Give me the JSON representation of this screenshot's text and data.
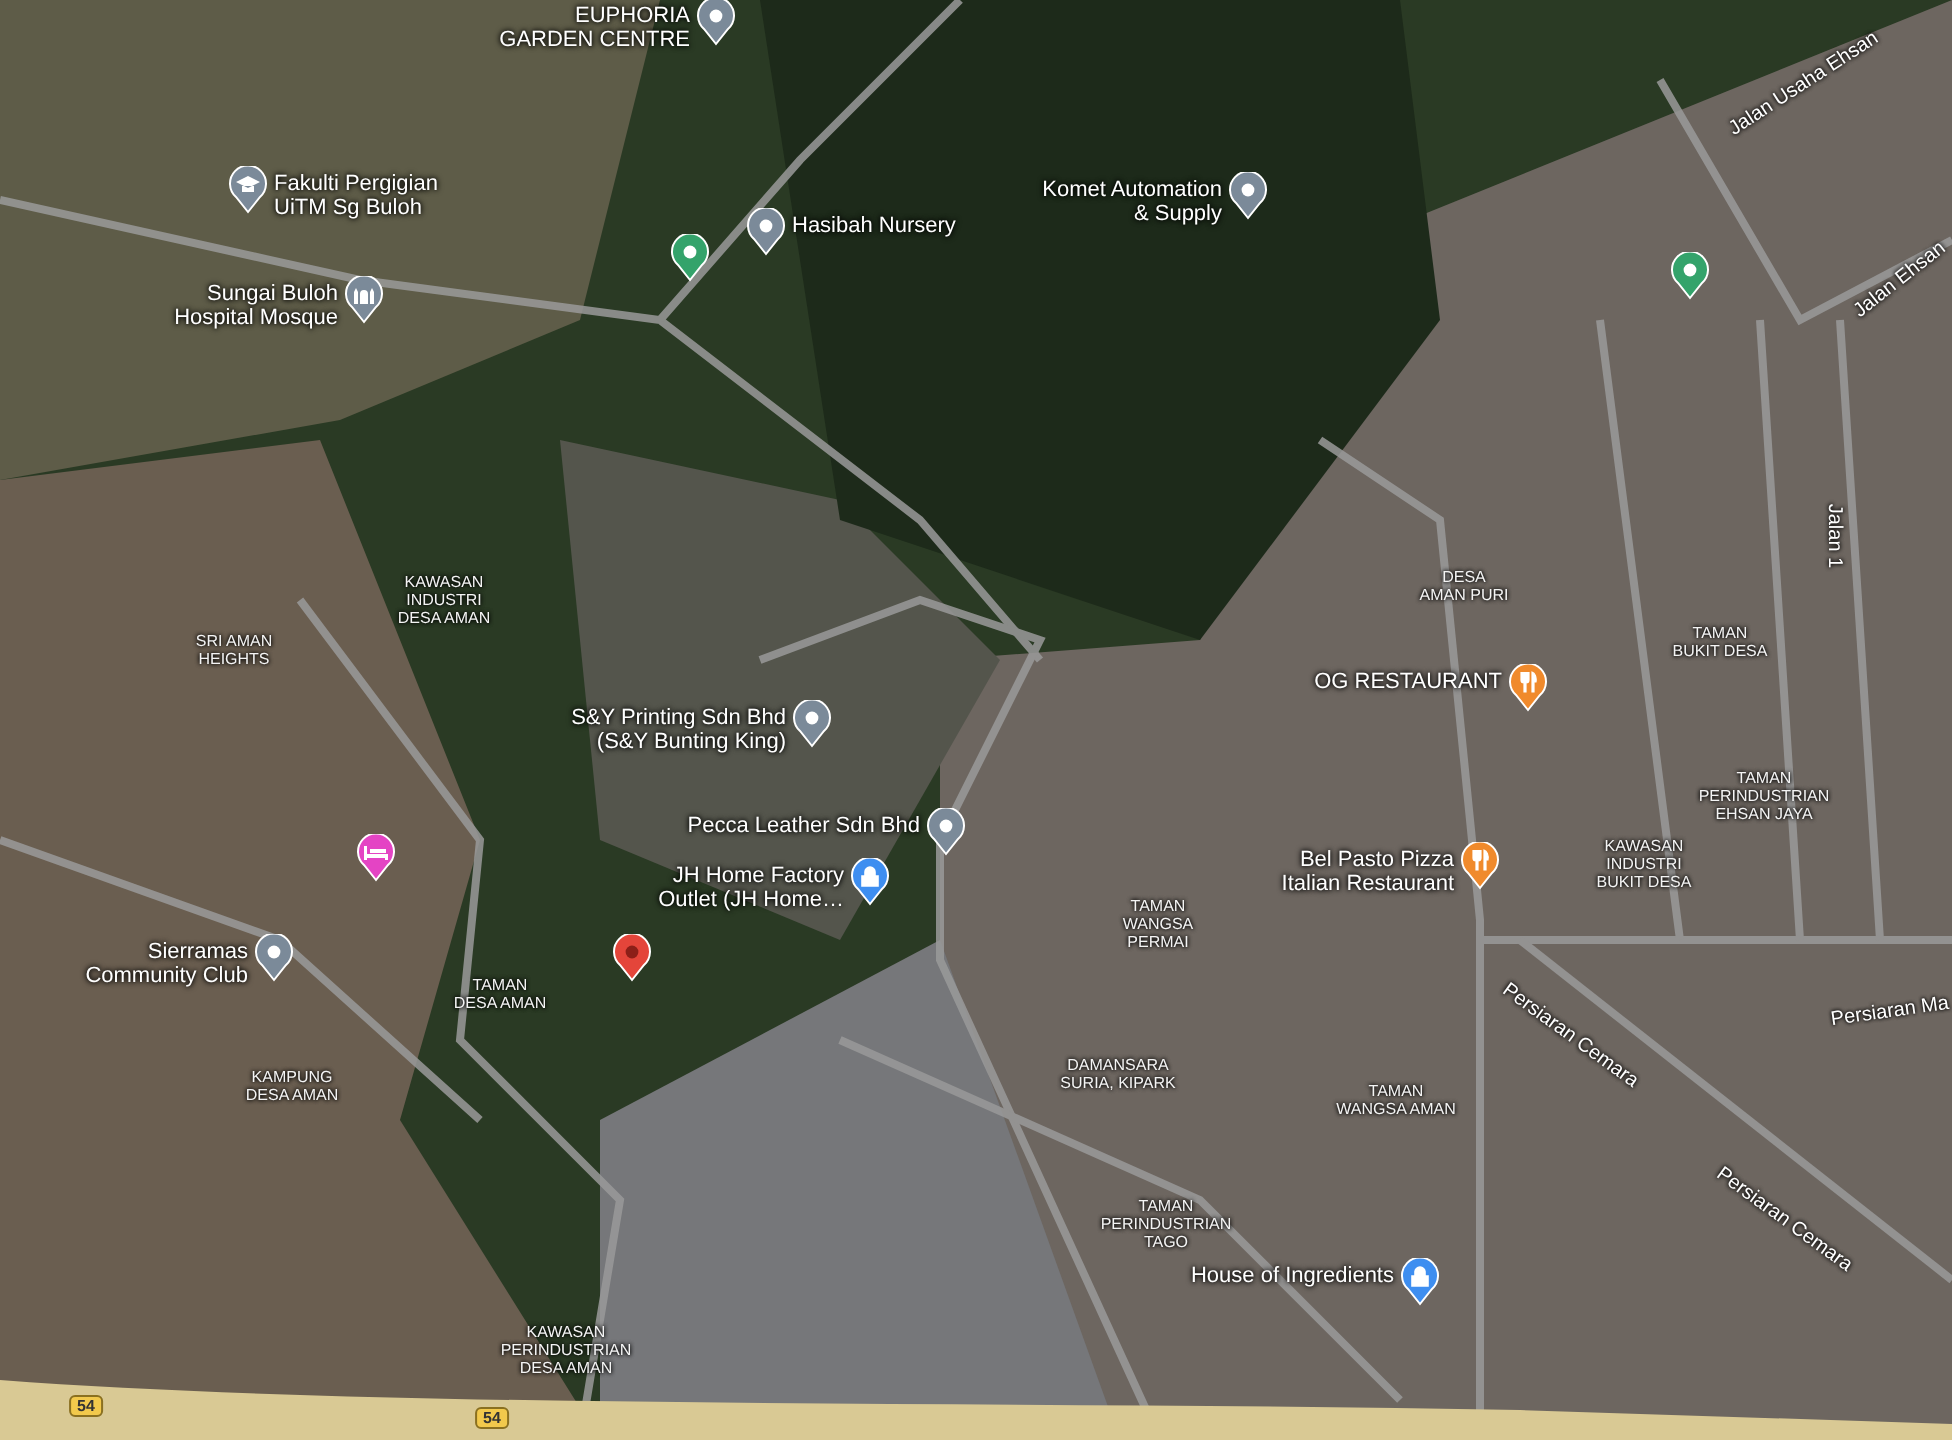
{
  "pois": [
    {
      "kind": "place",
      "lines": [
        "EUPHORIA",
        "GARDEN CENTRE"
      ]
    },
    {
      "kind": "school",
      "lines": [
        "Fakulti Pergigian",
        "UiTM Sg Buloh"
      ]
    },
    {
      "kind": "place",
      "lines": [
        "Hasibah Nursery"
      ]
    },
    {
      "kind": "park"
    },
    {
      "kind": "place",
      "lines": [
        "Komet Automation",
        "& Supply"
      ]
    },
    {
      "kind": "mosque",
      "lines": [
        "Sungai Buloh",
        "Hospital Mosque"
      ]
    },
    {
      "kind": "park"
    },
    {
      "kind": "place",
      "lines": [
        "S&Y Printing Sdn Bhd",
        "(S&Y Bunting King)"
      ]
    },
    {
      "kind": "place",
      "lines": [
        "Pecca Leather Sdn Bhd"
      ]
    },
    {
      "kind": "shop",
      "lines": [
        "JH Home Factory",
        "Outlet (JH Home…"
      ]
    },
    {
      "kind": "hotel"
    },
    {
      "kind": "dropped"
    },
    {
      "kind": "place",
      "lines": [
        "Sierramas",
        "Community Club"
      ]
    },
    {
      "kind": "restaurant",
      "lines": [
        "OG RESTAURANT"
      ]
    },
    {
      "kind": "restaurant",
      "lines": [
        "Bel Pasto Pizza",
        "Italian Restaurant"
      ]
    },
    {
      "kind": "shop",
      "lines": [
        "House of Ingredients"
      ]
    }
  ],
  "areas": [
    {
      "lines": [
        "KAWASAN",
        "INDUSTRI",
        "DESA AMAN"
      ]
    },
    {
      "lines": [
        "SRI AMAN",
        "HEIGHTS"
      ]
    },
    {
      "lines": [
        "DESA",
        "AMAN PURI"
      ]
    },
    {
      "lines": [
        "TAMAN",
        "BUKIT DESA"
      ]
    },
    {
      "lines": [
        "TAMAN",
        "PERINDUSTRIAN",
        "EHSAN JAYA"
      ]
    },
    {
      "lines": [
        "KAWASAN",
        "INDUSTRI",
        "BUKIT DESA"
      ]
    },
    {
      "lines": [
        "TAMAN",
        "WANGSA",
        "PERMAI"
      ]
    },
    {
      "lines": [
        "TAMAN",
        "DESA AMAN"
      ]
    },
    {
      "lines": [
        "KAMPUNG",
        "DESA AMAN"
      ]
    },
    {
      "lines": [
        "DAMANSARA",
        "SURIA, KIPARK"
      ]
    },
    {
      "lines": [
        "TAMAN",
        "WANGSA AMAN"
      ]
    },
    {
      "lines": [
        "TAMAN",
        "PERINDUSTRIAN",
        "TAGO"
      ]
    },
    {
      "lines": [
        "KAWASAN",
        "PERINDUSTRIAN",
        "DESA AMAN"
      ]
    }
  ],
  "streets": [
    {
      "text": "Jalan Usaha Ehsan"
    },
    {
      "text": "Jalan Ehsan"
    },
    {
      "text": "Jalan 1"
    },
    {
      "text": "Persiaran Cemara"
    },
    {
      "text": "Persiaran Cemara"
    },
    {
      "text": "Persiaran Ma"
    }
  ],
  "shields": [
    {
      "text": "54"
    },
    {
      "text": "54"
    }
  ]
}
